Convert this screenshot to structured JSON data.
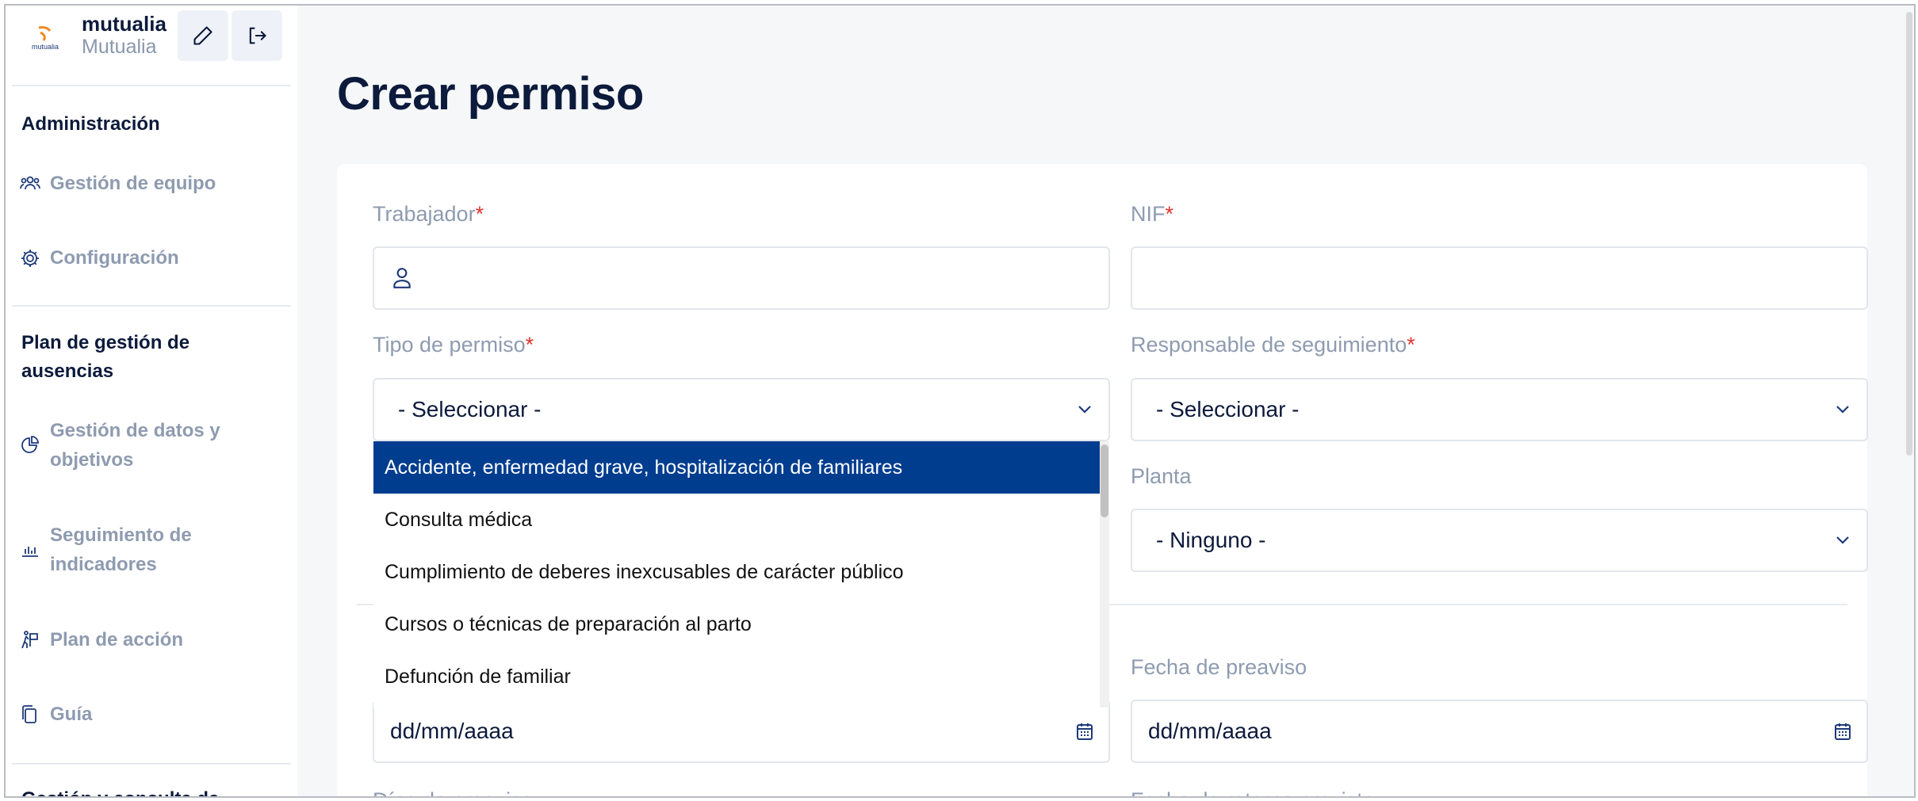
{
  "brand": {
    "name": "mutualia",
    "subtitle": "Mutualia",
    "logo_text": "mutualia"
  },
  "sidebar": {
    "section1": "Administración",
    "items1": [
      {
        "label": "Gestión de equipo",
        "icon": "team-icon"
      },
      {
        "label": "Configuración",
        "icon": "gear-icon"
      }
    ],
    "section2": "Plan de gestión de ausencias",
    "items2": [
      {
        "label": "Gestión de datos y objetivos",
        "icon": "pie-chart-icon"
      },
      {
        "label": "Seguimiento de indicadores",
        "icon": "bar-chart-icon"
      },
      {
        "label": "Plan de acción",
        "icon": "action-plan-icon"
      },
      {
        "label": "Guía",
        "icon": "copy-document-icon"
      }
    ],
    "section3": "Gestión y consulta de"
  },
  "main": {
    "title": "Crear permiso",
    "fields": {
      "trabajador": {
        "label": "Trabajador",
        "required": "*",
        "value": ""
      },
      "nif": {
        "label": "NIF",
        "required": "*",
        "value": ""
      },
      "tipo_permiso": {
        "label": "Tipo de permiso",
        "required": "*",
        "value": "- Seleccionar -"
      },
      "responsable": {
        "label": "Responsable de seguimiento",
        "required": "*",
        "value": "- Seleccionar -"
      },
      "planta": {
        "label": "Planta",
        "value": "- Ninguno -"
      },
      "fecha_inicio": {
        "value": "dd/mm/aaaa"
      },
      "fecha_preaviso": {
        "label": "Fecha de preaviso",
        "value": "dd/mm/aaaa"
      },
      "dias_preaviso": {
        "label": "Días de preaviso"
      },
      "fecha_retorno": {
        "label": "Fecha de retorno prevista"
      }
    },
    "dropdown_options": [
      "Accidente, enfermedad grave, hospitalización de familiares",
      "Consulta médica",
      "Cumplimiento de deberes inexcusables de carácter público",
      "Cursos o técnicas de preparación al parto",
      "Defunción de familiar"
    ]
  },
  "colors": {
    "navy": "#0c1a3b",
    "selected_option": "#003d8f",
    "muted": "#8e9bb0",
    "required": "#e3342f",
    "logo_orange": "#f08a24"
  }
}
